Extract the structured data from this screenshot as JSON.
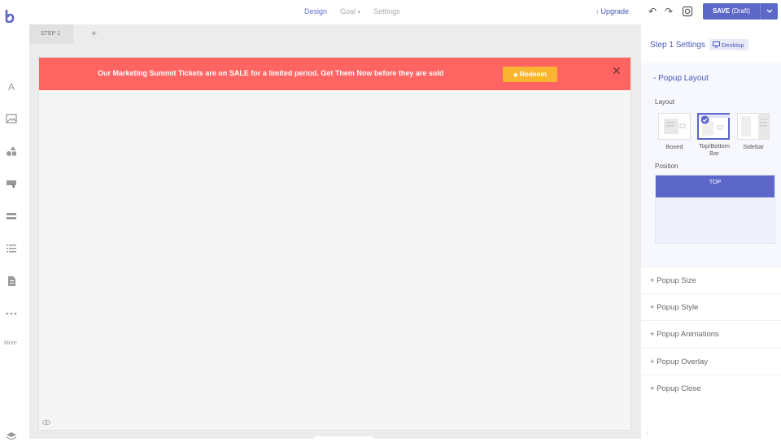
{
  "topbar": {
    "nav": [
      {
        "label": "Design"
      },
      {
        "label": "Goal"
      },
      {
        "label": "Settings"
      }
    ],
    "upgrade_label": "Upgrade",
    "save_label": "SAVE",
    "save_state": "(Draft)"
  },
  "leftbar": {
    "more_label": "More"
  },
  "canvas": {
    "tab_label": "STEP 1",
    "banner": {
      "text": "Our Marketing Summit Tickets are on SALE for a limited period. Get Them Now before they are sold",
      "button_label": "Redeem",
      "background_color": "#fe6461",
      "button_color": "#f9b530"
    }
  },
  "panel": {
    "title": "Step 1 Settings",
    "device_label": "Desktop",
    "layout_section": {
      "title": "- Popup Layout",
      "layout_label": "Layout",
      "options": [
        {
          "label": "Boxed",
          "selected": false
        },
        {
          "label": "Top/Bottom Bar",
          "selected": true
        },
        {
          "label": "Sidebar",
          "selected": false
        }
      ],
      "position_label": "Position",
      "position_value": "TOP"
    },
    "accordions": [
      {
        "label": "+ Popup Size"
      },
      {
        "label": "+ Popup Style"
      },
      {
        "label": "+ Popup Animations"
      },
      {
        "label": "+ Popup Overlay"
      },
      {
        "label": "+ Popup Close"
      }
    ]
  },
  "colors": {
    "accent": "#5c67c8"
  }
}
